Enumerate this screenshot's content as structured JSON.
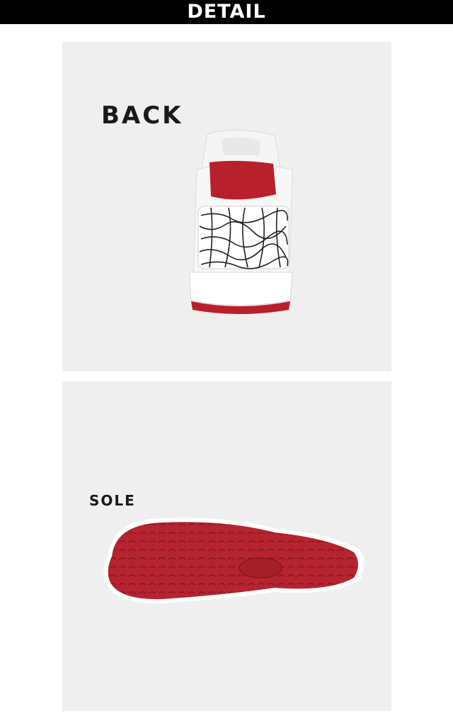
{
  "header": {
    "title": "DETAIL"
  },
  "panels": {
    "back": {
      "label": "BACK"
    },
    "sole": {
      "label": "SOLE"
    }
  },
  "colors": {
    "header_bg": "#000000",
    "panel_bg": "#efefef",
    "accent_red": "#b8202b",
    "shoe_white": "#f7f7f7"
  },
  "images": {
    "back": "shoe-back-view-photo",
    "sole": "shoe-sole-photo"
  }
}
